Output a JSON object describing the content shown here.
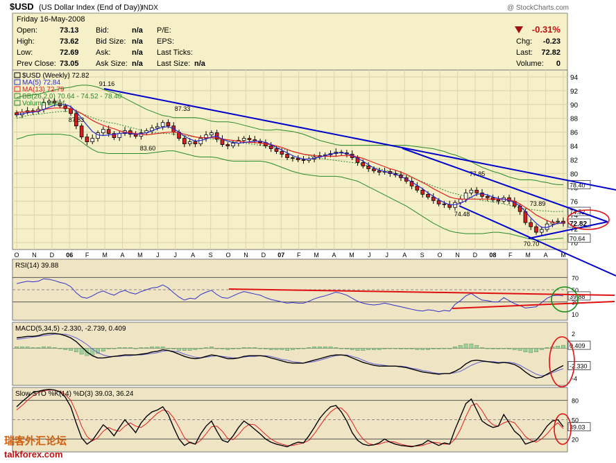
{
  "header": {
    "symbol": "$USD",
    "name": "(US Dollar Index (End of Day))",
    "exchange": "INDX",
    "copyright": "@ StockCharts.com",
    "date": "Friday  16-May-2008",
    "change_pct": "-0.31%",
    "fields": {
      "open": {
        "label": "Open:",
        "value": "73.13"
      },
      "high": {
        "label": "High:",
        "value": "73.62"
      },
      "low": {
        "label": "Low:",
        "value": "72.69"
      },
      "prev": {
        "label": "Prev Close:",
        "value": "73.05"
      },
      "bid": {
        "label": "Bid:",
        "value": "n/a"
      },
      "bidsize": {
        "label": "Bid Size:",
        "value": "n/a"
      },
      "ask": {
        "label": "Ask:",
        "value": "n/a"
      },
      "asksize": {
        "label": "Ask Size:",
        "value": "n/a"
      },
      "pe": {
        "label": "P/E:",
        "value": ""
      },
      "eps": {
        "label": "EPS:",
        "value": ""
      },
      "lastticks": {
        "label": "Last Ticks:",
        "value": ""
      },
      "lastsize": {
        "label": "Last Size:",
        "value": "n/a"
      },
      "chg": {
        "label": "Chg:",
        "value": "-0.23"
      },
      "last": {
        "label": "Last:",
        "value": "72.82"
      },
      "volume": {
        "label": "Volume:",
        "value": "0"
      }
    }
  },
  "watermark": {
    "cn": "瑞客外汇论坛",
    "en": "talkforex.com"
  },
  "colors": {
    "panel_bg": "#f5f0c8",
    "osc_bg": "#efe4c4",
    "up": "#ffffff",
    "down": "#d42020",
    "ma5": "#2a2ad0",
    "ma13": "#e02020",
    "bb": "#2a8a2a",
    "trend": "#0000cc",
    "annot_red": "#e01010",
    "annot_green": "#109010"
  },
  "chart_data": [
    {
      "type": "candlestick",
      "title": "$USD (Weekly) 72.82",
      "legend": [
        {
          "label": "$USD (Weekly) 72.82"
        },
        {
          "label": "MA(5) 72.84"
        },
        {
          "label": "MA(13) 72.79"
        },
        {
          "label": "BB(26,2.0) 70.64 - 74.52 - 78.40"
        },
        {
          "label": "Volume undef"
        }
      ],
      "ylim": [
        69.0,
        95.0
      ],
      "y_ticks": [
        70,
        72,
        74,
        76,
        78,
        80,
        82,
        84,
        86,
        88,
        90,
        92,
        94
      ],
      "x_labels": [
        "O",
        "N",
        "D",
        "06",
        "F",
        "M",
        "A",
        "M",
        "J",
        "J",
        "A",
        "S",
        "O",
        "N",
        "D",
        "07",
        "F",
        "M",
        "A",
        "M",
        "J",
        "J",
        "A",
        "S",
        "O",
        "N",
        "D",
        "08",
        "F",
        "M",
        "A",
        "M"
      ],
      "right_labels": [
        "78.40",
        "74.52",
        "72.82",
        "70.64"
      ],
      "annotations": [
        {
          "text": "91.16"
        },
        {
          "text": "87.83"
        },
        {
          "text": "87.33"
        },
        {
          "text": "83.60"
        },
        {
          "text": "77.85"
        },
        {
          "text": "74.48"
        },
        {
          "text": "73.89"
        },
        {
          "text": "70.70"
        }
      ],
      "closes": [
        88.5,
        88.9,
        89.1,
        89.0,
        89.3,
        90.3,
        90.5,
        90.2,
        89.8,
        89.4,
        88.7,
        86.9,
        85.3,
        84.6,
        85.1,
        85.9,
        86.4,
        85.8,
        85.2,
        85.8,
        86.2,
        85.7,
        85.4,
        85.9,
        86.2,
        86.6,
        86.8,
        87.4,
        86.9,
        86.0,
        85.1,
        84.3,
        84.6,
        84.3,
        85.1,
        85.6,
        85.9,
        85.0,
        84.2,
        84.0,
        84.4,
        84.8,
        85.1,
        84.9,
        84.7,
        84.5,
        84.0,
        83.6,
        83.2,
        82.8,
        82.3,
        82.2,
        82.0,
        81.9,
        82.1,
        82.4,
        82.6,
        82.7,
        82.9,
        83.1,
        83.0,
        82.8,
        82.3,
        81.6,
        81.1,
        80.7,
        80.4,
        80.2,
        80.3,
        80.0,
        79.8,
        79.4,
        78.9,
        78.2,
        77.6,
        77.0,
        76.6,
        76.1,
        75.6,
        75.5,
        75.1,
        75.8,
        76.3,
        77.2,
        77.6,
        77.2,
        76.7,
        76.5,
        76.2,
        76.0,
        76.5,
        76.0,
        75.3,
        74.5,
        72.9,
        72.3,
        71.5,
        71.9,
        72.7,
        73.0,
        73.1,
        72.8
      ],
      "ma5": [
        88.5,
        88.7,
        88.8,
        88.9,
        89.0,
        89.3,
        89.6,
        89.9,
        90.0,
        90.0,
        89.7,
        89.0,
        88.0,
        87.0,
        86.1,
        85.6,
        85.5,
        85.6,
        85.7,
        85.8,
        85.9,
        85.8,
        85.7,
        85.8,
        85.9,
        86.2,
        86.5,
        86.7,
        86.8,
        86.5,
        86.0,
        85.4,
        85.0,
        84.7,
        84.8,
        85.0,
        85.3,
        85.4,
        85.0,
        84.7,
        84.5,
        84.4,
        84.5,
        84.6,
        84.7,
        84.7,
        84.5,
        84.2,
        83.8,
        83.4,
        83.0,
        82.6,
        82.3,
        82.1,
        82.1,
        82.2,
        82.4,
        82.6,
        82.8,
        83.0,
        83.0,
        82.9,
        82.6,
        82.2,
        81.8,
        81.3,
        80.8,
        80.5,
        80.3,
        80.1,
        79.9,
        79.6,
        79.2,
        78.8,
        78.3,
        77.8,
        77.2,
        76.7,
        76.2,
        75.8,
        75.5,
        75.5,
        75.7,
        76.1,
        76.6,
        77.0,
        77.1,
        76.9,
        76.6,
        76.4,
        76.3,
        76.1,
        75.8,
        75.3,
        74.5,
        73.6,
        72.8,
        72.2,
        72.2,
        72.5,
        72.8,
        72.9
      ],
      "ma13": [
        88.9,
        88.9,
        89.0,
        89.0,
        89.1,
        89.3,
        89.4,
        89.5,
        89.5,
        89.5,
        89.4,
        89.1,
        88.7,
        88.2,
        87.7,
        87.3,
        87.0,
        86.7,
        86.5,
        86.2,
        86.0,
        85.9,
        85.8,
        85.7,
        85.6,
        85.7,
        85.8,
        85.9,
        86.0,
        86.0,
        85.9,
        85.7,
        85.5,
        85.3,
        85.2,
        85.2,
        85.2,
        85.1,
        85.0,
        84.9,
        84.8,
        84.7,
        84.6,
        84.5,
        84.5,
        84.4,
        84.3,
        84.2,
        84.0,
        83.8,
        83.5,
        83.2,
        83.0,
        82.8,
        82.7,
        82.6,
        82.5,
        82.5,
        82.5,
        82.5,
        82.6,
        82.6,
        82.6,
        82.4,
        82.2,
        81.9,
        81.6,
        81.3,
        81.0,
        80.7,
        80.5,
        80.2,
        79.9,
        79.5,
        79.1,
        78.7,
        78.3,
        77.8,
        77.4,
        77.0,
        76.6,
        76.4,
        76.3,
        76.3,
        76.3,
        76.3,
        76.3,
        76.3,
        76.3,
        76.3,
        76.3,
        76.2,
        76.0,
        75.6,
        75.1,
        74.6,
        74.0,
        73.6,
        73.2,
        72.9,
        72.8,
        72.8
      ],
      "bb_mid": [
        88.0,
        88.2,
        88.4,
        88.5,
        88.6,
        88.7,
        88.8,
        88.9,
        89.0,
        89.0,
        89.0,
        88.9,
        88.7,
        88.4,
        88.1,
        87.8,
        87.6,
        87.4,
        87.3,
        87.1,
        86.9,
        86.7,
        86.5,
        86.3,
        86.1,
        86.0,
        85.9,
        85.8,
        85.8,
        85.7,
        85.6,
        85.5,
        85.4,
        85.3,
        85.2,
        85.1,
        85.0,
        84.9,
        84.8,
        84.7,
        84.6,
        84.5,
        84.4,
        84.3,
        84.2,
        84.1,
        84.0,
        83.9,
        83.8,
        83.6,
        83.4,
        83.2,
        83.0,
        82.8,
        82.6,
        82.4,
        82.2,
        82.1,
        82.0,
        81.9,
        81.8,
        81.7,
        81.6,
        81.5,
        81.3,
        81.1,
        80.9,
        80.7,
        80.5,
        80.3,
        80.1,
        79.9,
        79.7,
        79.4,
        79.1,
        78.8,
        78.5,
        78.2,
        77.9,
        77.6,
        77.3,
        77.1,
        76.9,
        76.7,
        76.5,
        76.3,
        76.1,
        76.0,
        75.9,
        75.8,
        75.6,
        75.4,
        75.2,
        75.0,
        74.9,
        74.8,
        74.7,
        74.6,
        74.6,
        74.5,
        74.5,
        74.52
      ],
      "bb_half": [
        3.0,
        3.0,
        2.9,
        2.9,
        2.9,
        3.0,
        3.1,
        3.2,
        3.3,
        3.4,
        3.5,
        3.8,
        4.1,
        4.4,
        4.6,
        4.7,
        4.6,
        4.5,
        4.4,
        4.2,
        4.0,
        3.8,
        3.6,
        3.4,
        3.2,
        3.0,
        2.8,
        2.6,
        2.5,
        2.4,
        2.5,
        2.6,
        2.7,
        2.8,
        2.8,
        2.7,
        2.6,
        2.6,
        2.7,
        2.8,
        2.8,
        2.7,
        2.6,
        2.5,
        2.4,
        2.3,
        2.3,
        2.4,
        2.6,
        2.7,
        2.8,
        2.9,
        2.9,
        2.9,
        2.8,
        2.7,
        2.6,
        2.5,
        2.4,
        2.3,
        2.3,
        2.4,
        2.5,
        2.6,
        2.8,
        3.0,
        3.2,
        3.4,
        3.6,
        3.8,
        4.0,
        4.2,
        4.4,
        4.6,
        4.8,
        5.0,
        5.2,
        5.4,
        5.5,
        5.6,
        5.6,
        5.6,
        5.5,
        5.4,
        5.2,
        5.0,
        4.8,
        4.6,
        4.4,
        4.3,
        4.2,
        4.1,
        4.1,
        4.1,
        4.2,
        4.3,
        4.3,
        4.2,
        4.1,
        4.0,
        3.9,
        3.88
      ]
    },
    {
      "type": "line",
      "title": "RSI(14) 39.88",
      "ylim": [
        0,
        100
      ],
      "y_ticks": [
        10,
        30,
        50,
        70
      ],
      "right_labels": [
        "39.88"
      ],
      "values": [
        60,
        62,
        64,
        63,
        64,
        68,
        67,
        65,
        62,
        60,
        55,
        45,
        38,
        36,
        40,
        45,
        48,
        44,
        41,
        46,
        49,
        45,
        43,
        47,
        50,
        53,
        54,
        58,
        53,
        45,
        38,
        33,
        36,
        35,
        42,
        46,
        49,
        42,
        37,
        36,
        40,
        44,
        47,
        45,
        43,
        41,
        37,
        34,
        32,
        30,
        28,
        29,
        28,
        28,
        31,
        35,
        38,
        40,
        43,
        46,
        44,
        41,
        36,
        31,
        28,
        26,
        25,
        26,
        28,
        26,
        24,
        22,
        20,
        18,
        16,
        15,
        17,
        16,
        14,
        16,
        15,
        26,
        32,
        40,
        44,
        38,
        33,
        32,
        30,
        30,
        37,
        32,
        27,
        24,
        20,
        21,
        22,
        29,
        36,
        40,
        41,
        39.88
      ]
    },
    {
      "type": "bar+line",
      "title": "MACD(5,34,5) -2.330, -2.739, 0.409",
      "ylim": [
        -5,
        3.5
      ],
      "y_ticks": [
        -4,
        2
      ],
      "right_labels": [
        "0.409",
        "-2.330"
      ],
      "macd": [
        1.4,
        1.5,
        1.6,
        1.6,
        1.7,
        1.9,
        2.0,
        2.0,
        1.9,
        1.7,
        1.4,
        0.9,
        0.2,
        -0.5,
        -1.0,
        -1.3,
        -1.3,
        -1.2,
        -1.1,
        -1.0,
        -0.9,
        -0.9,
        -0.9,
        -0.8,
        -0.7,
        -0.5,
        -0.4,
        -0.2,
        -0.3,
        -0.5,
        -0.8,
        -1.1,
        -1.3,
        -1.4,
        -1.3,
        -1.1,
        -0.9,
        -1.0,
        -1.2,
        -1.4,
        -1.4,
        -1.3,
        -1.1,
        -1.0,
        -1.0,
        -1.0,
        -1.1,
        -1.3,
        -1.5,
        -1.7,
        -1.9,
        -2.0,
        -2.0,
        -2.0,
        -1.8,
        -1.6,
        -1.4,
        -1.2,
        -1.0,
        -0.9,
        -0.9,
        -1.0,
        -1.3,
        -1.6,
        -1.9,
        -2.1,
        -2.3,
        -2.4,
        -2.4,
        -2.4,
        -2.4,
        -2.5,
        -2.6,
        -2.8,
        -3.0,
        -3.2,
        -3.3,
        -3.4,
        -3.5,
        -3.4,
        -3.4,
        -3.1,
        -2.7,
        -2.1,
        -1.7,
        -1.6,
        -1.7,
        -1.8,
        -1.9,
        -2.0,
        -1.9,
        -2.0,
        -2.2,
        -2.6,
        -3.2,
        -3.7,
        -4.0,
        -3.9,
        -3.5,
        -3.1,
        -2.7,
        -2.33
      ],
      "signal": [
        1.2,
        1.3,
        1.4,
        1.5,
        1.6,
        1.7,
        1.8,
        1.9,
        1.9,
        1.9,
        1.7,
        1.4,
        1.0,
        0.5,
        -0.1,
        -0.6,
        -0.9,
        -1.1,
        -1.1,
        -1.1,
        -1.0,
        -1.0,
        -0.9,
        -0.9,
        -0.8,
        -0.7,
        -0.6,
        -0.4,
        -0.3,
        -0.4,
        -0.5,
        -0.8,
        -1.0,
        -1.2,
        -1.3,
        -1.2,
        -1.1,
        -1.0,
        -1.1,
        -1.2,
        -1.3,
        -1.3,
        -1.2,
        -1.1,
        -1.1,
        -1.0,
        -1.0,
        -1.1,
        -1.3,
        -1.5,
        -1.6,
        -1.8,
        -1.9,
        -2.0,
        -1.9,
        -1.8,
        -1.6,
        -1.4,
        -1.2,
        -1.0,
        -0.9,
        -0.9,
        -1.1,
        -1.3,
        -1.6,
        -1.9,
        -2.1,
        -2.2,
        -2.3,
        -2.4,
        -2.4,
        -2.4,
        -2.5,
        -2.7,
        -2.8,
        -3.0,
        -3.1,
        -3.3,
        -3.4,
        -3.4,
        -3.4,
        -3.3,
        -3.1,
        -2.7,
        -2.3,
        -2.0,
        -1.8,
        -1.8,
        -1.8,
        -1.9,
        -1.9,
        -1.9,
        -2.0,
        -2.3,
        -2.7,
        -3.1,
        -3.5,
        -3.7,
        -3.6,
        -3.3,
        -3.0,
        -2.739
      ]
    },
    {
      "type": "line",
      "title": "Slow STO %K(14) %D(3) 39.03, 36.24",
      "ylim": [
        0,
        100
      ],
      "y_ticks": [
        20,
        50,
        80
      ],
      "right_labels": [
        "50",
        "39.03"
      ],
      "k": [
        70,
        78,
        85,
        92,
        94,
        96,
        97,
        96,
        93,
        85,
        70,
        45,
        22,
        12,
        18,
        30,
        42,
        35,
        25,
        38,
        50,
        40,
        30,
        45,
        55,
        62,
        65,
        70,
        58,
        38,
        20,
        10,
        15,
        12,
        28,
        40,
        48,
        32,
        18,
        15,
        25,
        38,
        48,
        42,
        35,
        28,
        20,
        15,
        12,
        10,
        8,
        12,
        15,
        14,
        25,
        38,
        52,
        62,
        70,
        72,
        62,
        48,
        30,
        18,
        12,
        10,
        11,
        14,
        20,
        15,
        12,
        10,
        9,
        8,
        10,
        12,
        18,
        14,
        10,
        14,
        12,
        35,
        55,
        75,
        82,
        65,
        48,
        42,
        38,
        40,
        58,
        45,
        32,
        25,
        12,
        15,
        18,
        28,
        40,
        48,
        50,
        39.03
      ],
      "d": [
        65,
        72,
        80,
        87,
        92,
        95,
        96,
        96,
        94,
        89,
        80,
        62,
        40,
        24,
        17,
        22,
        32,
        38,
        34,
        32,
        40,
        45,
        40,
        38,
        44,
        52,
        60,
        65,
        63,
        53,
        38,
        22,
        14,
        12,
        18,
        28,
        39,
        40,
        32,
        21,
        19,
        27,
        37,
        43,
        42,
        35,
        27,
        20,
        15,
        12,
        10,
        10,
        12,
        14,
        18,
        28,
        40,
        52,
        62,
        68,
        68,
        60,
        46,
        31,
        20,
        13,
        11,
        12,
        15,
        16,
        15,
        12,
        10,
        9,
        9,
        10,
        13,
        15,
        14,
        12,
        12,
        20,
        35,
        55,
        72,
        75,
        64,
        50,
        42,
        40,
        45,
        48,
        45,
        35,
        24,
        18,
        15,
        20,
        28,
        38,
        45,
        36.24
      ]
    }
  ]
}
